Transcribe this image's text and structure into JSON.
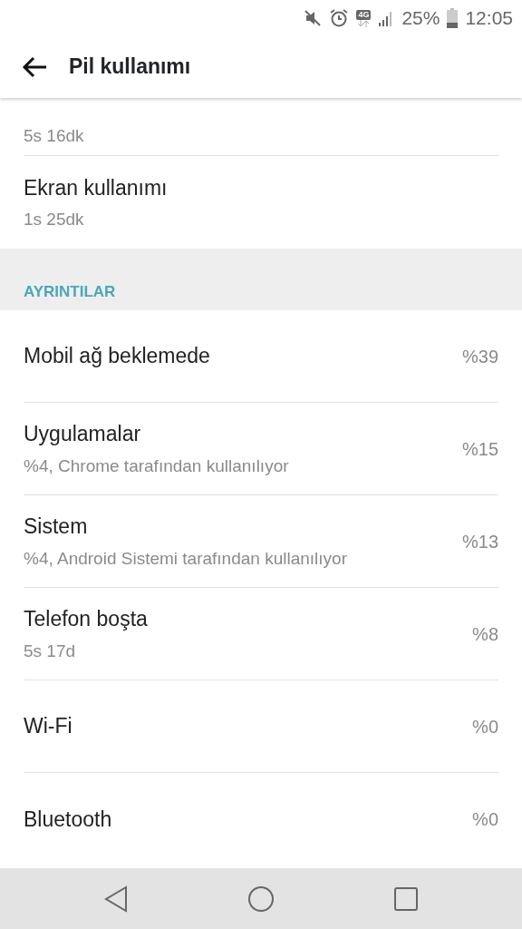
{
  "status_bar": {
    "battery": "25%",
    "time": "12:05",
    "network": "4G"
  },
  "app_bar": {
    "title": "Pil kullanımı"
  },
  "summary": [
    {
      "subtitle": "5s 16dk"
    },
    {
      "title": "Ekran kullanımı",
      "subtitle": "1s 25dk"
    }
  ],
  "section": {
    "header": "AYRINTILAR"
  },
  "items": [
    {
      "title": "Mobil ağ beklemede",
      "value": "%39"
    },
    {
      "title": "Uygulamalar",
      "subtitle": "%4, Chrome tarafından kullanılıyor",
      "value": "%15"
    },
    {
      "title": "Sistem",
      "subtitle": "%4, Android Sistemi tarafından kullanılıyor",
      "value": "%13"
    },
    {
      "title": "Telefon boşta",
      "subtitle": "5s 17d",
      "value": "%8"
    },
    {
      "title": "Wi-Fi",
      "value": "%0"
    },
    {
      "title": "Bluetooth",
      "value": "%0"
    }
  ]
}
